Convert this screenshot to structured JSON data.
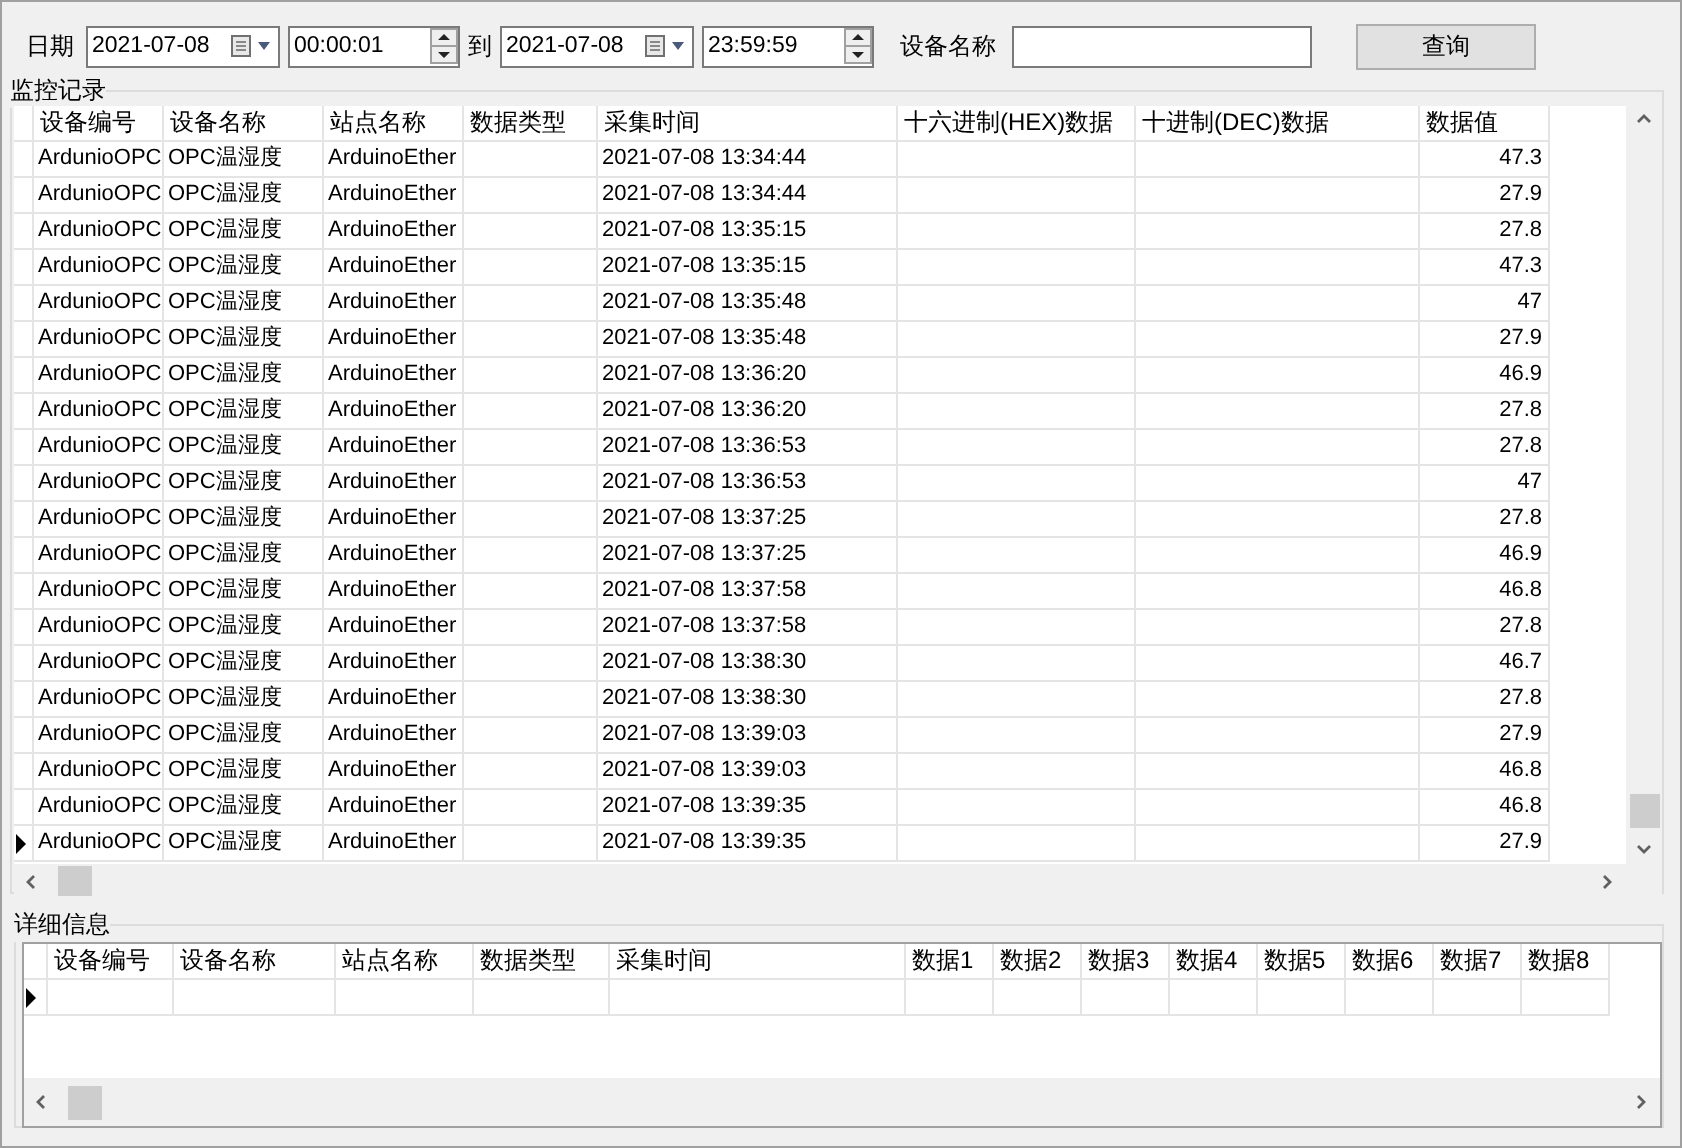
{
  "filter": {
    "date_label": "日期",
    "start_date": "2021-07-08",
    "start_time": "00:00:01",
    "to_label": "到",
    "end_date": "2021-07-08",
    "end_time": "23:59:59",
    "device_label": "设备名称",
    "query_button": "查询"
  },
  "monitor": {
    "title": "监控记录",
    "columns": [
      "设备编号",
      "设备名称",
      "站点名称",
      "数据类型",
      "采集时间",
      "十六进制(HEX)数据",
      "十进制(DEC)数据",
      "数据值"
    ],
    "rows": [
      {
        "id": "ArdunioOPC",
        "name": "OPC温湿度",
        "station": "ArduinoEther",
        "time": "2021-07-08 13:34:44",
        "value": "47.3",
        "current": false
      },
      {
        "id": "ArdunioOPC",
        "name": "OPC温湿度",
        "station": "ArduinoEther",
        "time": "2021-07-08 13:34:44",
        "value": "27.9",
        "current": false
      },
      {
        "id": "ArdunioOPC",
        "name": "OPC温湿度",
        "station": "ArduinoEther",
        "time": "2021-07-08 13:35:15",
        "value": "27.8",
        "current": false
      },
      {
        "id": "ArdunioOPC",
        "name": "OPC温湿度",
        "station": "ArduinoEther",
        "time": "2021-07-08 13:35:15",
        "value": "47.3",
        "current": false
      },
      {
        "id": "ArdunioOPC",
        "name": "OPC温湿度",
        "station": "ArduinoEther",
        "time": "2021-07-08 13:35:48",
        "value": "47",
        "current": false
      },
      {
        "id": "ArdunioOPC",
        "name": "OPC温湿度",
        "station": "ArduinoEther",
        "time": "2021-07-08 13:35:48",
        "value": "27.9",
        "current": false
      },
      {
        "id": "ArdunioOPC",
        "name": "OPC温湿度",
        "station": "ArduinoEther",
        "time": "2021-07-08 13:36:20",
        "value": "46.9",
        "current": false
      },
      {
        "id": "ArdunioOPC",
        "name": "OPC温湿度",
        "station": "ArduinoEther",
        "time": "2021-07-08 13:36:20",
        "value": "27.8",
        "current": false
      },
      {
        "id": "ArdunioOPC",
        "name": "OPC温湿度",
        "station": "ArduinoEther",
        "time": "2021-07-08 13:36:53",
        "value": "27.8",
        "current": false
      },
      {
        "id": "ArdunioOPC",
        "name": "OPC温湿度",
        "station": "ArduinoEther",
        "time": "2021-07-08 13:36:53",
        "value": "47",
        "current": false
      },
      {
        "id": "ArdunioOPC",
        "name": "OPC温湿度",
        "station": "ArduinoEther",
        "time": "2021-07-08 13:37:25",
        "value": "27.8",
        "current": false
      },
      {
        "id": "ArdunioOPC",
        "name": "OPC温湿度",
        "station": "ArduinoEther",
        "time": "2021-07-08 13:37:25",
        "value": "46.9",
        "current": false
      },
      {
        "id": "ArdunioOPC",
        "name": "OPC温湿度",
        "station": "ArduinoEther",
        "time": "2021-07-08 13:37:58",
        "value": "46.8",
        "current": false
      },
      {
        "id": "ArdunioOPC",
        "name": "OPC温湿度",
        "station": "ArduinoEther",
        "time": "2021-07-08 13:37:58",
        "value": "27.8",
        "current": false
      },
      {
        "id": "ArdunioOPC",
        "name": "OPC温湿度",
        "station": "ArduinoEther",
        "time": "2021-07-08 13:38:30",
        "value": "46.7",
        "current": false
      },
      {
        "id": "ArdunioOPC",
        "name": "OPC温湿度",
        "station": "ArduinoEther",
        "time": "2021-07-08 13:38:30",
        "value": "27.8",
        "current": false
      },
      {
        "id": "ArdunioOPC",
        "name": "OPC温湿度",
        "station": "ArduinoEther",
        "time": "2021-07-08 13:39:03",
        "value": "27.9",
        "current": false
      },
      {
        "id": "ArdunioOPC",
        "name": "OPC温湿度",
        "station": "ArduinoEther",
        "time": "2021-07-08 13:39:03",
        "value": "46.8",
        "current": false
      },
      {
        "id": "ArdunioOPC",
        "name": "OPC温湿度",
        "station": "ArduinoEther",
        "time": "2021-07-08 13:39:35",
        "value": "46.8",
        "current": false
      },
      {
        "id": "ArdunioOPC",
        "name": "OPC温湿度",
        "station": "ArduinoEther",
        "time": "2021-07-08 13:39:35",
        "value": "27.9",
        "current": true
      }
    ]
  },
  "detail": {
    "title": "详细信息",
    "columns": [
      "设备编号",
      "设备名称",
      "站点名称",
      "数据类型",
      "采集时间",
      "数据1",
      "数据2",
      "数据3",
      "数据4",
      "数据5",
      "数据6",
      "数据7",
      "数据8"
    ],
    "rows": [
      {
        "current": true
      }
    ]
  }
}
